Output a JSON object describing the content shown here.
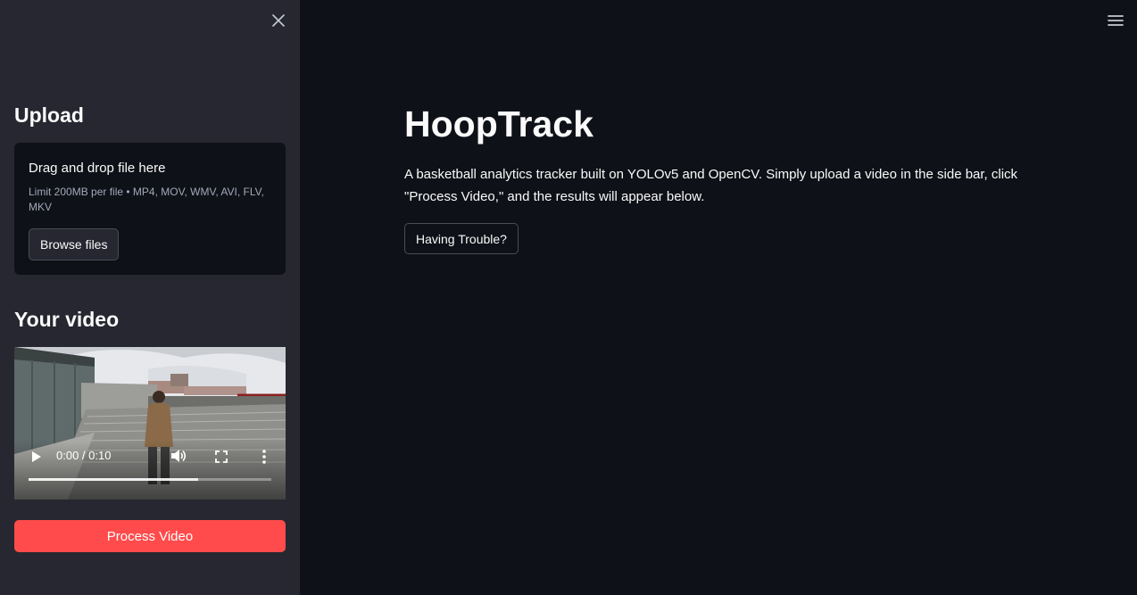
{
  "sidebar": {
    "upload_heading": "Upload",
    "dropzone": {
      "title": "Drag and drop file here",
      "limit": "Limit 200MB per file • MP4, MOV, WMV, AVI, FLV, MKV",
      "browse_label": "Browse files"
    },
    "video_heading": "Your video",
    "video": {
      "time": "0:00 / 0:10",
      "buffered_fraction": 0.7,
      "icons": [
        "play-icon",
        "volume-icon",
        "fullscreen-icon",
        "more-options-icon"
      ]
    },
    "process_label": "Process Video",
    "close_icon": "close-icon"
  },
  "header": {
    "menu_icon": "hamburger-menu-icon"
  },
  "main": {
    "title": "HoopTrack",
    "description": "A basketball analytics tracker built on YOLOv5 and OpenCV. Simply upload a video in the side bar, click \"Process Video,\" and the results will appear below.",
    "trouble_label": "Having Trouble?"
  },
  "colors": {
    "sidebar_bg": "#262730",
    "main_bg": "#0e1117",
    "primary": "#ff4b4b",
    "text": "#fafafa"
  }
}
